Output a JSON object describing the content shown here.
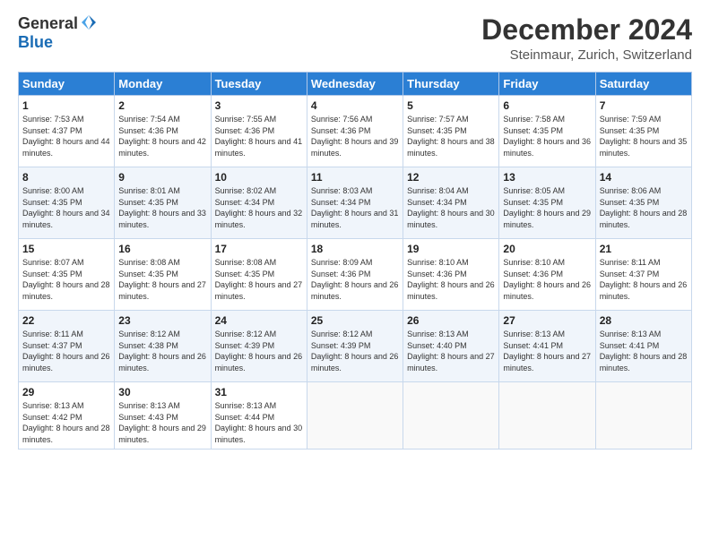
{
  "logo": {
    "general": "General",
    "blue": "Blue"
  },
  "title": "December 2024",
  "location": "Steinmaur, Zurich, Switzerland",
  "days_of_week": [
    "Sunday",
    "Monday",
    "Tuesday",
    "Wednesday",
    "Thursday",
    "Friday",
    "Saturday"
  ],
  "weeks": [
    [
      {
        "day": "1",
        "sunrise": "7:53 AM",
        "sunset": "4:37 PM",
        "daylight": "8 hours and 44 minutes."
      },
      {
        "day": "2",
        "sunrise": "7:54 AM",
        "sunset": "4:36 PM",
        "daylight": "8 hours and 42 minutes."
      },
      {
        "day": "3",
        "sunrise": "7:55 AM",
        "sunset": "4:36 PM",
        "daylight": "8 hours and 41 minutes."
      },
      {
        "day": "4",
        "sunrise": "7:56 AM",
        "sunset": "4:36 PM",
        "daylight": "8 hours and 39 minutes."
      },
      {
        "day": "5",
        "sunrise": "7:57 AM",
        "sunset": "4:35 PM",
        "daylight": "8 hours and 38 minutes."
      },
      {
        "day": "6",
        "sunrise": "7:58 AM",
        "sunset": "4:35 PM",
        "daylight": "8 hours and 36 minutes."
      },
      {
        "day": "7",
        "sunrise": "7:59 AM",
        "sunset": "4:35 PM",
        "daylight": "8 hours and 35 minutes."
      }
    ],
    [
      {
        "day": "8",
        "sunrise": "8:00 AM",
        "sunset": "4:35 PM",
        "daylight": "8 hours and 34 minutes."
      },
      {
        "day": "9",
        "sunrise": "8:01 AM",
        "sunset": "4:35 PM",
        "daylight": "8 hours and 33 minutes."
      },
      {
        "day": "10",
        "sunrise": "8:02 AM",
        "sunset": "4:34 PM",
        "daylight": "8 hours and 32 minutes."
      },
      {
        "day": "11",
        "sunrise": "8:03 AM",
        "sunset": "4:34 PM",
        "daylight": "8 hours and 31 minutes."
      },
      {
        "day": "12",
        "sunrise": "8:04 AM",
        "sunset": "4:34 PM",
        "daylight": "8 hours and 30 minutes."
      },
      {
        "day": "13",
        "sunrise": "8:05 AM",
        "sunset": "4:35 PM",
        "daylight": "8 hours and 29 minutes."
      },
      {
        "day": "14",
        "sunrise": "8:06 AM",
        "sunset": "4:35 PM",
        "daylight": "8 hours and 28 minutes."
      }
    ],
    [
      {
        "day": "15",
        "sunrise": "8:07 AM",
        "sunset": "4:35 PM",
        "daylight": "8 hours and 28 minutes."
      },
      {
        "day": "16",
        "sunrise": "8:08 AM",
        "sunset": "4:35 PM",
        "daylight": "8 hours and 27 minutes."
      },
      {
        "day": "17",
        "sunrise": "8:08 AM",
        "sunset": "4:35 PM",
        "daylight": "8 hours and 27 minutes."
      },
      {
        "day": "18",
        "sunrise": "8:09 AM",
        "sunset": "4:36 PM",
        "daylight": "8 hours and 26 minutes."
      },
      {
        "day": "19",
        "sunrise": "8:10 AM",
        "sunset": "4:36 PM",
        "daylight": "8 hours and 26 minutes."
      },
      {
        "day": "20",
        "sunrise": "8:10 AM",
        "sunset": "4:36 PM",
        "daylight": "8 hours and 26 minutes."
      },
      {
        "day": "21",
        "sunrise": "8:11 AM",
        "sunset": "4:37 PM",
        "daylight": "8 hours and 26 minutes."
      }
    ],
    [
      {
        "day": "22",
        "sunrise": "8:11 AM",
        "sunset": "4:37 PM",
        "daylight": "8 hours and 26 minutes."
      },
      {
        "day": "23",
        "sunrise": "8:12 AM",
        "sunset": "4:38 PM",
        "daylight": "8 hours and 26 minutes."
      },
      {
        "day": "24",
        "sunrise": "8:12 AM",
        "sunset": "4:39 PM",
        "daylight": "8 hours and 26 minutes."
      },
      {
        "day": "25",
        "sunrise": "8:12 AM",
        "sunset": "4:39 PM",
        "daylight": "8 hours and 26 minutes."
      },
      {
        "day": "26",
        "sunrise": "8:13 AM",
        "sunset": "4:40 PM",
        "daylight": "8 hours and 27 minutes."
      },
      {
        "day": "27",
        "sunrise": "8:13 AM",
        "sunset": "4:41 PM",
        "daylight": "8 hours and 27 minutes."
      },
      {
        "day": "28",
        "sunrise": "8:13 AM",
        "sunset": "4:41 PM",
        "daylight": "8 hours and 28 minutes."
      }
    ],
    [
      {
        "day": "29",
        "sunrise": "8:13 AM",
        "sunset": "4:42 PM",
        "daylight": "8 hours and 28 minutes."
      },
      {
        "day": "30",
        "sunrise": "8:13 AM",
        "sunset": "4:43 PM",
        "daylight": "8 hours and 29 minutes."
      },
      {
        "day": "31",
        "sunrise": "8:13 AM",
        "sunset": "4:44 PM",
        "daylight": "8 hours and 30 minutes."
      },
      null,
      null,
      null,
      null
    ]
  ]
}
